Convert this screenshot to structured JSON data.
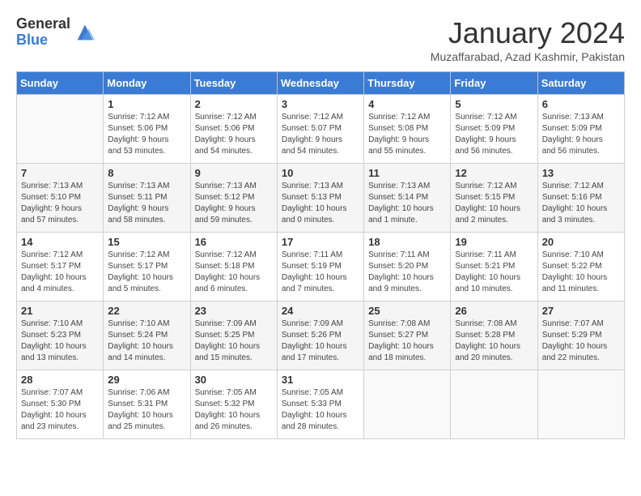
{
  "logo": {
    "general": "General",
    "blue": "Blue"
  },
  "title": "January 2024",
  "location": "Muzaffarabad, Azad Kashmir, Pakistan",
  "days_of_week": [
    "Sunday",
    "Monday",
    "Tuesday",
    "Wednesday",
    "Thursday",
    "Friday",
    "Saturday"
  ],
  "weeks": [
    [
      {
        "day": "",
        "info": ""
      },
      {
        "day": "1",
        "info": "Sunrise: 7:12 AM\nSunset: 5:06 PM\nDaylight: 9 hours\nand 53 minutes."
      },
      {
        "day": "2",
        "info": "Sunrise: 7:12 AM\nSunset: 5:06 PM\nDaylight: 9 hours\nand 54 minutes."
      },
      {
        "day": "3",
        "info": "Sunrise: 7:12 AM\nSunset: 5:07 PM\nDaylight: 9 hours\nand 54 minutes."
      },
      {
        "day": "4",
        "info": "Sunrise: 7:12 AM\nSunset: 5:08 PM\nDaylight: 9 hours\nand 55 minutes."
      },
      {
        "day": "5",
        "info": "Sunrise: 7:12 AM\nSunset: 5:09 PM\nDaylight: 9 hours\nand 56 minutes."
      },
      {
        "day": "6",
        "info": "Sunrise: 7:13 AM\nSunset: 5:09 PM\nDaylight: 9 hours\nand 56 minutes."
      }
    ],
    [
      {
        "day": "7",
        "info": "Sunrise: 7:13 AM\nSunset: 5:10 PM\nDaylight: 9 hours\nand 57 minutes."
      },
      {
        "day": "8",
        "info": "Sunrise: 7:13 AM\nSunset: 5:11 PM\nDaylight: 9 hours\nand 58 minutes."
      },
      {
        "day": "9",
        "info": "Sunrise: 7:13 AM\nSunset: 5:12 PM\nDaylight: 9 hours\nand 59 minutes."
      },
      {
        "day": "10",
        "info": "Sunrise: 7:13 AM\nSunset: 5:13 PM\nDaylight: 10 hours\nand 0 minutes."
      },
      {
        "day": "11",
        "info": "Sunrise: 7:13 AM\nSunset: 5:14 PM\nDaylight: 10 hours\nand 1 minute."
      },
      {
        "day": "12",
        "info": "Sunrise: 7:12 AM\nSunset: 5:15 PM\nDaylight: 10 hours\nand 2 minutes."
      },
      {
        "day": "13",
        "info": "Sunrise: 7:12 AM\nSunset: 5:16 PM\nDaylight: 10 hours\nand 3 minutes."
      }
    ],
    [
      {
        "day": "14",
        "info": "Sunrise: 7:12 AM\nSunset: 5:17 PM\nDaylight: 10 hours\nand 4 minutes."
      },
      {
        "day": "15",
        "info": "Sunrise: 7:12 AM\nSunset: 5:17 PM\nDaylight: 10 hours\nand 5 minutes."
      },
      {
        "day": "16",
        "info": "Sunrise: 7:12 AM\nSunset: 5:18 PM\nDaylight: 10 hours\nand 6 minutes."
      },
      {
        "day": "17",
        "info": "Sunrise: 7:11 AM\nSunset: 5:19 PM\nDaylight: 10 hours\nand 7 minutes."
      },
      {
        "day": "18",
        "info": "Sunrise: 7:11 AM\nSunset: 5:20 PM\nDaylight: 10 hours\nand 9 minutes."
      },
      {
        "day": "19",
        "info": "Sunrise: 7:11 AM\nSunset: 5:21 PM\nDaylight: 10 hours\nand 10 minutes."
      },
      {
        "day": "20",
        "info": "Sunrise: 7:10 AM\nSunset: 5:22 PM\nDaylight: 10 hours\nand 11 minutes."
      }
    ],
    [
      {
        "day": "21",
        "info": "Sunrise: 7:10 AM\nSunset: 5:23 PM\nDaylight: 10 hours\nand 13 minutes."
      },
      {
        "day": "22",
        "info": "Sunrise: 7:10 AM\nSunset: 5:24 PM\nDaylight: 10 hours\nand 14 minutes."
      },
      {
        "day": "23",
        "info": "Sunrise: 7:09 AM\nSunset: 5:25 PM\nDaylight: 10 hours\nand 15 minutes."
      },
      {
        "day": "24",
        "info": "Sunrise: 7:09 AM\nSunset: 5:26 PM\nDaylight: 10 hours\nand 17 minutes."
      },
      {
        "day": "25",
        "info": "Sunrise: 7:08 AM\nSunset: 5:27 PM\nDaylight: 10 hours\nand 18 minutes."
      },
      {
        "day": "26",
        "info": "Sunrise: 7:08 AM\nSunset: 5:28 PM\nDaylight: 10 hours\nand 20 minutes."
      },
      {
        "day": "27",
        "info": "Sunrise: 7:07 AM\nSunset: 5:29 PM\nDaylight: 10 hours\nand 22 minutes."
      }
    ],
    [
      {
        "day": "28",
        "info": "Sunrise: 7:07 AM\nSunset: 5:30 PM\nDaylight: 10 hours\nand 23 minutes."
      },
      {
        "day": "29",
        "info": "Sunrise: 7:06 AM\nSunset: 5:31 PM\nDaylight: 10 hours\nand 25 minutes."
      },
      {
        "day": "30",
        "info": "Sunrise: 7:05 AM\nSunset: 5:32 PM\nDaylight: 10 hours\nand 26 minutes."
      },
      {
        "day": "31",
        "info": "Sunrise: 7:05 AM\nSunset: 5:33 PM\nDaylight: 10 hours\nand 28 minutes."
      },
      {
        "day": "",
        "info": ""
      },
      {
        "day": "",
        "info": ""
      },
      {
        "day": "",
        "info": ""
      }
    ]
  ]
}
